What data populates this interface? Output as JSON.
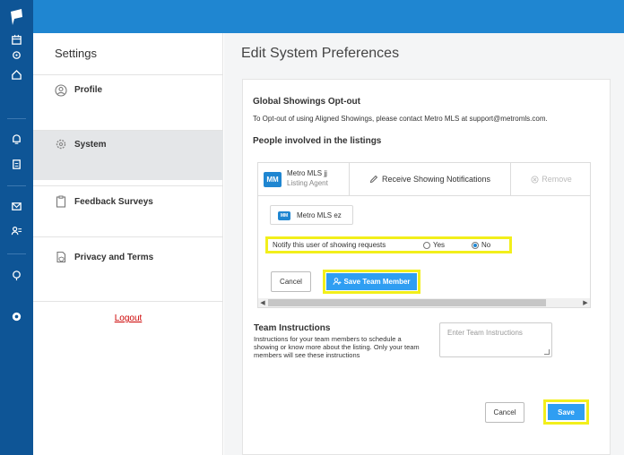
{
  "sidebar": {
    "title": "Settings",
    "items": [
      {
        "label": "Profile"
      },
      {
        "label": "System"
      },
      {
        "label": "Feedback Surveys"
      },
      {
        "label": "Privacy and Terms"
      }
    ],
    "logout": "Logout"
  },
  "main": {
    "title": "Edit System Preferences",
    "opt_out": {
      "heading": "Global Showings Opt-out",
      "text": "To Opt-out of using Aligned Showings, please contact Metro MLS at support@metromls.com."
    },
    "people_heading": "People involved in the listings",
    "member": {
      "initials": "MM",
      "name": "Metro MLS jj",
      "role": "Listing Agent",
      "notifications": "Receive Showing Notifications",
      "remove": "Remove"
    },
    "chip": {
      "initials": "MM",
      "name": "Metro MLS ez"
    },
    "notify": {
      "question": "Notify this user of showing requests",
      "yes": "Yes",
      "no": "No",
      "selected": "No"
    },
    "cancel_label": "Cancel",
    "save_team_label": "Save Team Member",
    "team_instructions": {
      "heading": "Team Instructions",
      "text": "Instructions for your team members to schedule a showing or know more about the listing. Only your team members will see these instructions",
      "placeholder": "Enter Team Instructions"
    },
    "footer": {
      "cancel": "Cancel",
      "save": "Save"
    }
  },
  "colors": {
    "topbar": "#1f86d1",
    "rail": "#0e5596",
    "accent": "#2f9ef2",
    "highlight": "#f2ef1b",
    "logout": "#cc0000"
  }
}
